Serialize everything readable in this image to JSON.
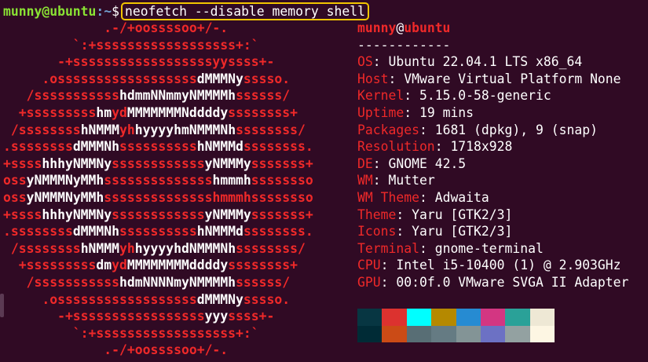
{
  "prompt": {
    "user_host": "munny@ubuntu",
    "path": ":~",
    "symbol": "$",
    "command": "neofetch --disable memory shell"
  },
  "logo_lines": [
    [
      [
        "r",
        "             .-/+oossssoo+/-."
      ]
    ],
    [
      [
        "r",
        "         `:+ssssssssssssssssss+:`"
      ]
    ],
    [
      [
        "r",
        "       -+ssssssssssssssssssyyssss+-"
      ]
    ],
    [
      [
        "r",
        "     .ossssssssssssssssss"
      ],
      [
        "w",
        "dMMMNy"
      ],
      [
        "r",
        "sssso."
      ]
    ],
    [
      [
        "r",
        "   /sssssssssss"
      ],
      [
        "w",
        "hdmmNNmmyNMMMMh"
      ],
      [
        "r",
        "ssssss/"
      ]
    ],
    [
      [
        "r",
        "  +sssssssss"
      ],
      [
        "w",
        "hm"
      ],
      [
        "r",
        "yd"
      ],
      [
        "w",
        "MMMMMMMNddddy"
      ],
      [
        "r",
        "ssssssss+"
      ]
    ],
    [
      [
        "r",
        " /ssssssss"
      ],
      [
        "w",
        "hNMMM"
      ],
      [
        "r",
        "yh"
      ],
      [
        "w",
        "hyyyyhmNMMMNh"
      ],
      [
        "r",
        "ssssssss/"
      ]
    ],
    [
      [
        "r",
        ".ssssssss"
      ],
      [
        "w",
        "dMMMNh"
      ],
      [
        "r",
        "ssssssssss"
      ],
      [
        "w",
        "hNMMMd"
      ],
      [
        "r",
        "ssssssss."
      ]
    ],
    [
      [
        "r",
        "+ssss"
      ],
      [
        "w",
        "hhhyNMMNy"
      ],
      [
        "r",
        "ssssssssssss"
      ],
      [
        "w",
        "yNMMMy"
      ],
      [
        "r",
        "sssssss+"
      ]
    ],
    [
      [
        "r",
        "oss"
      ],
      [
        "w",
        "yNMMMNyMMh"
      ],
      [
        "r",
        "ssssssssssssss"
      ],
      [
        "w",
        "hmmmh"
      ],
      [
        "r",
        "ssssssso"
      ]
    ],
    [
      [
        "r",
        "oss"
      ],
      [
        "w",
        "yNMMMNyMMh"
      ],
      [
        "r",
        "sssssssssssssshmmmhssssssso"
      ]
    ],
    [
      [
        "r",
        "+ssss"
      ],
      [
        "w",
        "hhhyNMMNy"
      ],
      [
        "r",
        "ssssssssssss"
      ],
      [
        "w",
        "yNMMMy"
      ],
      [
        "r",
        "sssssss+"
      ]
    ],
    [
      [
        "r",
        ".ssssssss"
      ],
      [
        "w",
        "dMMMNh"
      ],
      [
        "r",
        "ssssssssss"
      ],
      [
        "w",
        "hNMMMd"
      ],
      [
        "r",
        "ssssssss."
      ]
    ],
    [
      [
        "r",
        " /ssssssss"
      ],
      [
        "w",
        "hNMMM"
      ],
      [
        "r",
        "yh"
      ],
      [
        "w",
        "hyyyyhdNMMMNh"
      ],
      [
        "r",
        "ssssssss/"
      ]
    ],
    [
      [
        "r",
        "  +sssssssss"
      ],
      [
        "w",
        "dm"
      ],
      [
        "r",
        "yd"
      ],
      [
        "w",
        "MMMMMMMMddddy"
      ],
      [
        "r",
        "ssssssss+"
      ]
    ],
    [
      [
        "r",
        "   /sssssssssss"
      ],
      [
        "w",
        "hdmNNNNmyNMMMMh"
      ],
      [
        "r",
        "ssssss/"
      ]
    ],
    [
      [
        "r",
        "     .ossssssssssssssssss"
      ],
      [
        "w",
        "dMMMNy"
      ],
      [
        "r",
        "sssso."
      ]
    ],
    [
      [
        "r",
        "       -+sssssssssssssssss"
      ],
      [
        "w",
        "yyy"
      ],
      [
        "r",
        "ssss+-"
      ]
    ],
    [
      [
        "r",
        "         `:+ssssssssssssssssss+:`"
      ]
    ],
    [
      [
        "r",
        "             .-/+oossssoo+/-."
      ]
    ]
  ],
  "info": {
    "title_user": "munny",
    "title_at": "@",
    "title_host": "ubuntu",
    "separator": "------------",
    "rows": [
      {
        "key": "OS",
        "value": "Ubuntu 22.04.1 LTS x86_64"
      },
      {
        "key": "Host",
        "value": "VMware Virtual Platform None"
      },
      {
        "key": "Kernel",
        "value": "5.15.0-58-generic"
      },
      {
        "key": "Uptime",
        "value": "19 mins"
      },
      {
        "key": "Packages",
        "value": "1681 (dpkg), 9 (snap)"
      },
      {
        "key": "Resolution",
        "value": "1718x928"
      },
      {
        "key": "DE",
        "value": "GNOME 42.5"
      },
      {
        "key": "WM",
        "value": "Mutter"
      },
      {
        "key": "WM Theme",
        "value": "Adwaita"
      },
      {
        "key": "Theme",
        "value": "Yaru [GTK2/3]"
      },
      {
        "key": "Icons",
        "value": "Yaru [GTK2/3]"
      },
      {
        "key": "Terminal",
        "value": "gnome-terminal"
      },
      {
        "key": "CPU",
        "value": "Intel i5-10400 (1) @ 2.903GHz"
      },
      {
        "key": "GPU",
        "value": "00:0f.0 VMware SVGA II Adapter"
      }
    ],
    "key_value_sep": ": "
  },
  "palette": {
    "row1": [
      "#073642",
      "#dc322f",
      "#00ffff",
      "#b58900",
      "#268bd2",
      "#d33682",
      "#2aa198",
      "#eee8d5"
    ],
    "row2": [
      "#002b36",
      "#cb4b16",
      "#586e75",
      "#657b83",
      "#839496",
      "#6c71c4",
      "#93a1a1",
      "#fdf6e3"
    ]
  },
  "colors": {
    "background": "#300a24",
    "logo_red": "#ef2929",
    "prompt_green": "#8ae234",
    "prompt_blue": "#729fcf",
    "highlight_border": "#f2c500"
  }
}
